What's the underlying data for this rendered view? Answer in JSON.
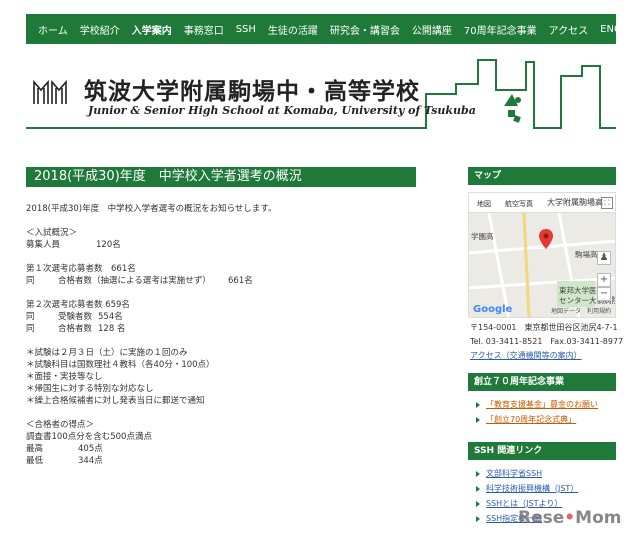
{
  "nav": {
    "items": [
      "ホーム",
      "学校紹介",
      "入学案内",
      "事務窓口",
      "SSH",
      "生徒の活躍",
      "研究会・講習会",
      "公開講座",
      "70周年記念事業",
      "アクセス",
      "ENGLISH"
    ],
    "active_index": 2
  },
  "header": {
    "title_jp": "筑波大学附属駒場中・高等学校",
    "title_en": "Junior & Senior High School at Komaba, University of Tsukuba"
  },
  "main": {
    "title": "2018(平成30)年度　中学校入学者選考の概況",
    "intro": "2018(平成30)年度　中学校入学者選考の概況をお知らせします。",
    "section1_head": "＜入試概況＞",
    "recruit_label": "募集人員",
    "recruit_value": "120名",
    "first_applicants": "第１次選考応募者数　661名",
    "first_same": "同",
    "first_passers_label": "合格者数（抽選による選考は実施せず）",
    "first_passers_value": "661名",
    "second_applicants": "第２次選考応募者数 659名",
    "second_same1": "同",
    "second_takers_label": "受験者数",
    "second_takers_value": "554名",
    "second_same2": "同",
    "second_passers_label": "合格者数",
    "second_passers_value": "128 名",
    "notes": [
      "＊試験は２月３日（土）に実施の１回のみ",
      "＊試験科目は国数理社４教科（各40分・100点）",
      "＊面接・実技等なし",
      "＊帰国生に対する特別な対応なし",
      "＊繰上合格候補者に対し発表当日に郵送で通知"
    ],
    "section2_head": "＜合格者の得点＞",
    "score_basis": "調査書100点分を含む500点満点",
    "max_label": "最高",
    "max_value": "405点",
    "min_label": "最低",
    "min_value": "344点"
  },
  "sidebar": {
    "map_head": "マップ",
    "map": {
      "tab_map": "地図",
      "tab_satellite": "航空写真",
      "place": "大学附属駒場高",
      "label_left": "学園高",
      "label_right": "駒場高",
      "label_bottom1": "東邦大学医療",
      "label_bottom2": "センター大橋病院",
      "google": "Google",
      "copy": "地図データ　利用規約"
    },
    "address": "〒154-0001　東京都世田谷区池尻4-7-1",
    "tel": "Tel. 03-3411-8521　Fax.03-3411-8977",
    "access_link": "アクセス（交通機関等の案内）",
    "anniv_head": "創立７０周年記念事業",
    "anniv_links": [
      "「教育支援基金」募金のお願い",
      "「創立70周年記念式典」"
    ],
    "ssh_head": "SSH 関連リンク",
    "ssh_links": [
      "文部科学省SSH",
      "科学技術振興機構（JST）",
      "SSHとは（JSTより）",
      "SSH指定校一覧"
    ]
  },
  "watermark": {
    "text_a": "Rese",
    "text_b": "Mom",
    "dot": "•"
  },
  "colors": {
    "brand_green": "#1f7a3a",
    "link_blue": "#2a5db0",
    "link_orange": "#c75a00"
  }
}
